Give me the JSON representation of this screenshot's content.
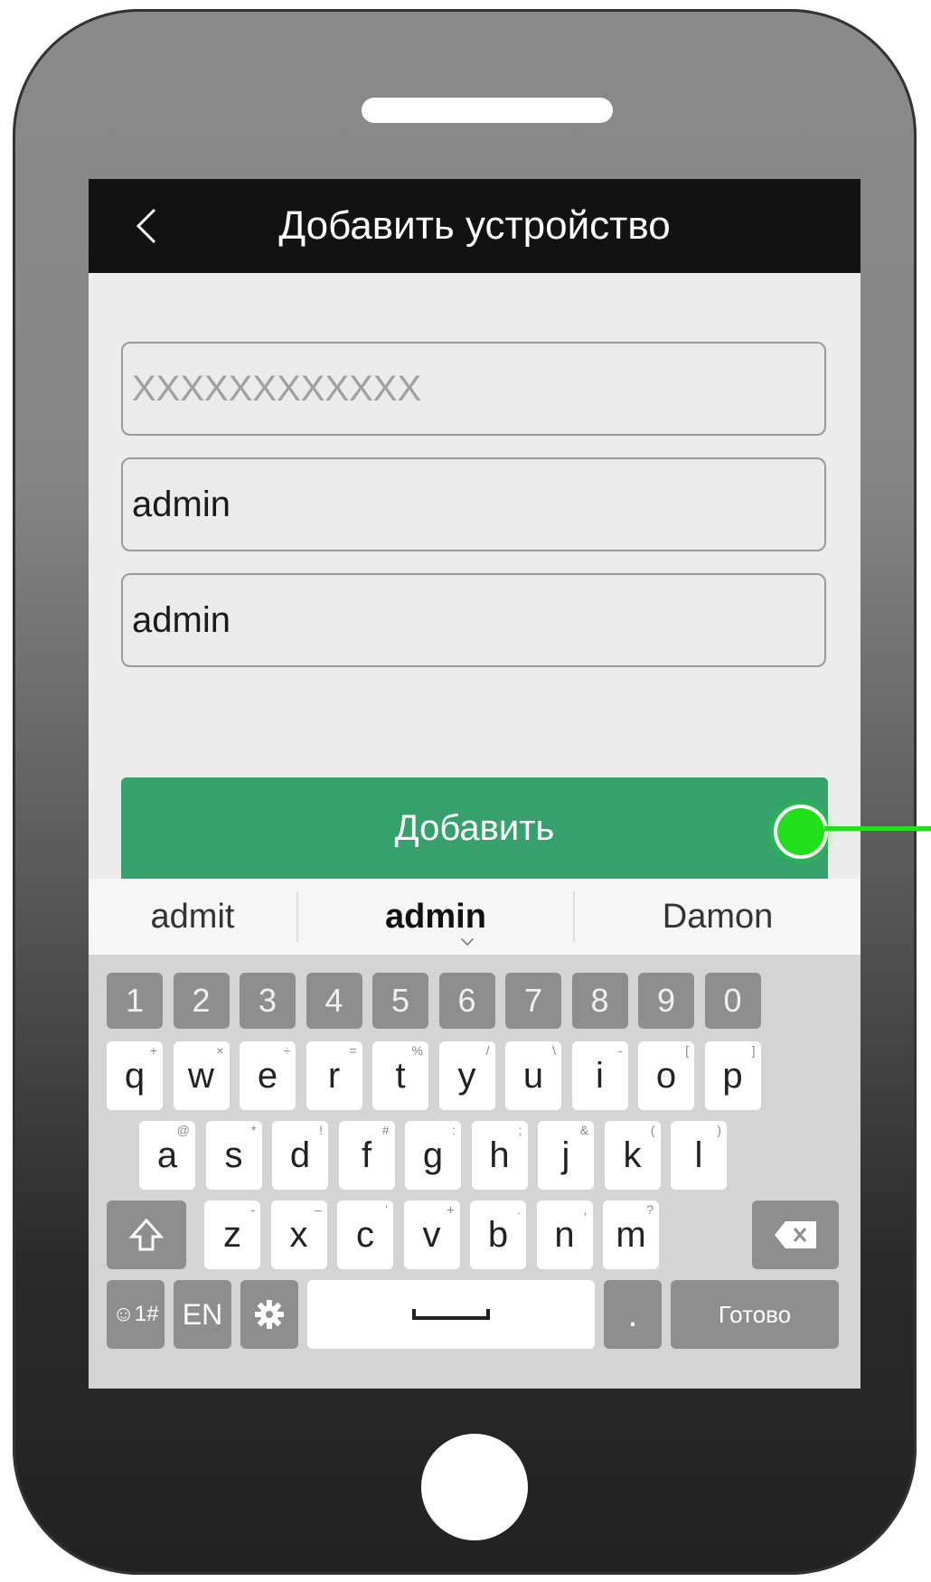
{
  "header": {
    "back_icon": "chevron-left-icon",
    "title": "Добавить устройство"
  },
  "form": {
    "serial_placeholder": "XXXXXXXXXXXX",
    "username_value": "admin",
    "password_value": "admin",
    "add_label": "Добавить"
  },
  "suggestions": [
    "admit",
    "admin",
    "Damon"
  ],
  "keyboard": {
    "number_row": [
      "1",
      "2",
      "3",
      "4",
      "5",
      "6",
      "7",
      "8",
      "9",
      "0"
    ],
    "row1": [
      {
        "k": "q",
        "s": "+"
      },
      {
        "k": "w",
        "s": "×"
      },
      {
        "k": "e",
        "s": "÷"
      },
      {
        "k": "r",
        "s": "="
      },
      {
        "k": "t",
        "s": "%"
      },
      {
        "k": "y",
        "s": "/"
      },
      {
        "k": "u",
        "s": "\\"
      },
      {
        "k": "i",
        "s": "-"
      },
      {
        "k": "o",
        "s": "["
      },
      {
        "k": "p",
        "s": "]"
      }
    ],
    "row2": [
      {
        "k": "a",
        "s": "@"
      },
      {
        "k": "s",
        "s": "*"
      },
      {
        "k": "d",
        "s": "!"
      },
      {
        "k": "f",
        "s": "#"
      },
      {
        "k": "g",
        "s": ":"
      },
      {
        "k": "h",
        "s": ";"
      },
      {
        "k": "j",
        "s": "&"
      },
      {
        "k": "k",
        "s": "("
      },
      {
        "k": "l",
        "s": ")"
      }
    ],
    "row3": [
      {
        "k": "z",
        "s": "-"
      },
      {
        "k": "x",
        "s": "–"
      },
      {
        "k": "c",
        "s": "'"
      },
      {
        "k": "v",
        "s": "+"
      },
      {
        "k": "b",
        "s": "."
      },
      {
        "k": "n",
        "s": ","
      },
      {
        "k": "m",
        "s": "?"
      }
    ],
    "symbols_label": "☺1#",
    "lang_label": "EN",
    "settings_icon": "gear-icon",
    "space_icon": "space-bar-icon",
    "period_label": ".",
    "done_label": "Готово",
    "shift_icon": "shift-icon",
    "backspace_icon": "backspace-icon"
  },
  "colors": {
    "accent": "#36a16c",
    "marker": "#22e01a",
    "topbar": "#121212"
  }
}
